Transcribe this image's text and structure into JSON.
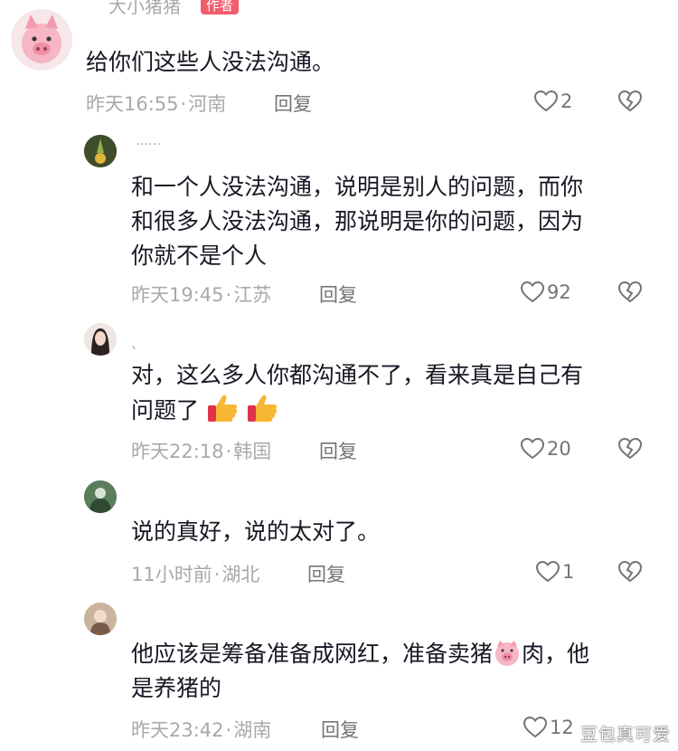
{
  "comments": [
    {
      "username": "大小猪猪",
      "badge": "作者",
      "lines": [
        "给你们这些人没法沟通。"
      ],
      "time": "昨天16:55",
      "location": "河南",
      "reply_label": "回复",
      "likes": "2"
    },
    {
      "username": "……",
      "lines": [
        "和一个人没法沟通，说明是别人的问题，而你",
        "和很多人没法沟通，那说明是你的问题，因为",
        "你就不是个人"
      ],
      "time": "昨天19:45",
      "location": "江苏",
      "reply_label": "回复",
      "likes": "92"
    },
    {
      "username": "、",
      "lines": [
        "对，这么多人你都沟通不了，看来真是自己有",
        "问题了"
      ],
      "time": "昨天22:18",
      "location": "韩国",
      "reply_label": "回复",
      "likes": "20"
    },
    {
      "lines": [
        "说的真好，说的太对了。"
      ],
      "time": "11小时前",
      "location": "湖北",
      "reply_label": "回复",
      "likes": "1"
    },
    {
      "lines": [
        "他应该是筹备准备成网红，准备卖猪",
        "肉，他",
        "是养猪的"
      ],
      "time": "昨天23:42",
      "location": "湖南",
      "reply_label": "回复",
      "likes": "12"
    }
  ],
  "separator": "·",
  "watermark": "豆包真可爱",
  "icons": {
    "like": "heart-outline-icon",
    "dislike": "broken-heart-icon",
    "thumbs": "thumbs-up-emoji-icon",
    "pig": "pig-face-emoji-icon"
  },
  "colors": {
    "text": "#161823",
    "meta": "#a8a9ad",
    "action": "#737479",
    "badge": "#f25d6c"
  }
}
